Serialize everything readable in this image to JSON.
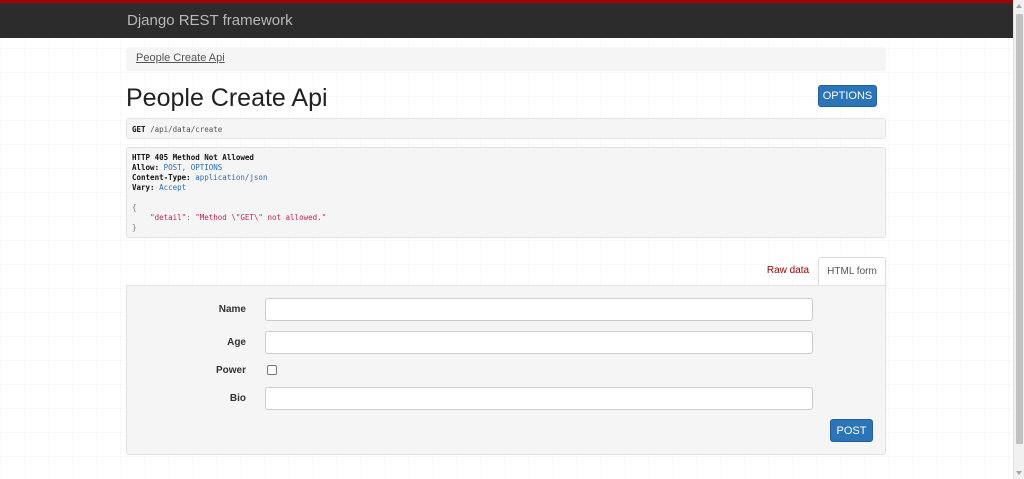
{
  "navbar": {
    "brand": "Django REST framework"
  },
  "breadcrumb": {
    "items": [
      "People Create Api"
    ]
  },
  "page": {
    "title": "People Create Api",
    "options_button": "OPTIONS"
  },
  "request": {
    "method": "GET",
    "path": "/api/data/create"
  },
  "response": {
    "status_line": "HTTP 405 Method Not Allowed",
    "headers": [
      {
        "name": "Allow:",
        "value": "POST, OPTIONS"
      },
      {
        "name": "Content-Type:",
        "value": "application/json"
      },
      {
        "name": "Vary:",
        "value": "Accept"
      }
    ],
    "body_open": "{",
    "body_key": "\"detail\"",
    "body_sep": ": ",
    "body_value": "\"Method \\\"GET\\\" not allowed.\"",
    "body_close": "}"
  },
  "tabs": {
    "raw": "Raw data",
    "html": "HTML form"
  },
  "form": {
    "fields": [
      {
        "label": "Name",
        "value": ""
      },
      {
        "label": "Age",
        "value": ""
      },
      {
        "label": "Power",
        "checked": false
      },
      {
        "label": "Bio",
        "value": ""
      }
    ],
    "submit": "POST"
  },
  "colors": {
    "navbar_bg": "#2c2c2c",
    "navbar_accent": "#a30000",
    "primary_button": "#2c74b8",
    "raw_tab_text": "#a30000",
    "json_text": "#c7254e",
    "header_value": "#2a6fb5"
  }
}
